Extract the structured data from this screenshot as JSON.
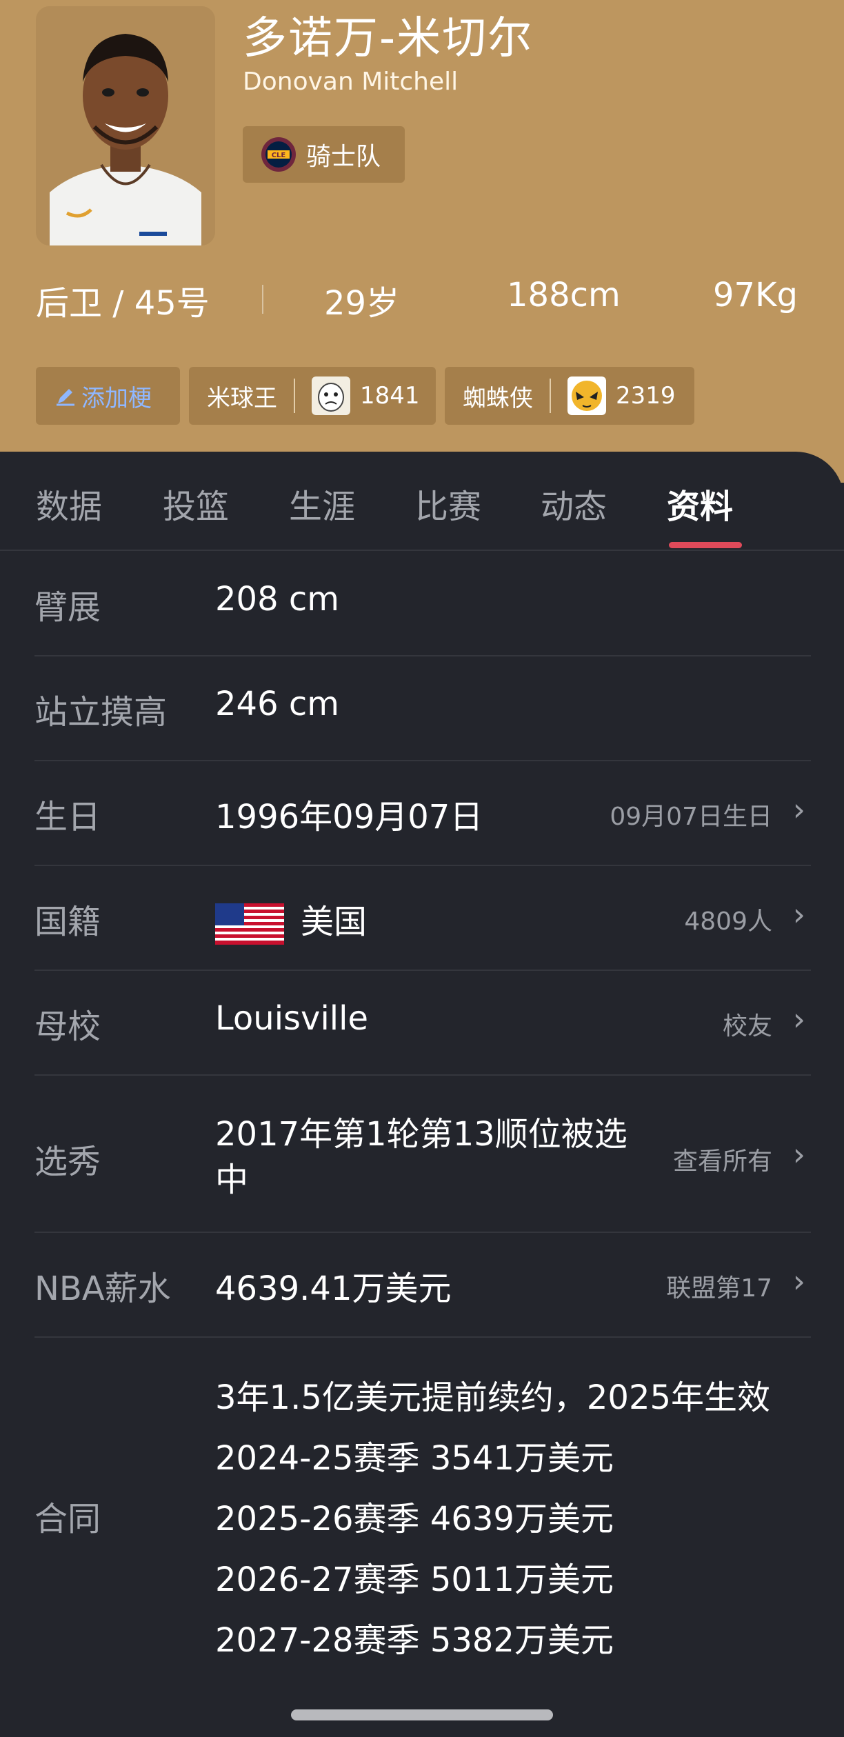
{
  "player": {
    "name_cn": "多诺万-米切尔",
    "name_en": "Donovan Mitchell",
    "team": "骑士队",
    "position_number": "后卫 / 45号",
    "age": "29岁",
    "height": "188cm",
    "weight": "97Kg"
  },
  "tags": {
    "add_label": "添加梗",
    "tag1": {
      "label": "米球王",
      "count": "1841"
    },
    "tag2": {
      "label": "蜘蛛侠",
      "count": "2319"
    }
  },
  "tabs": [
    "数据",
    "投篮",
    "生涯",
    "比赛",
    "动态",
    "资料"
  ],
  "active_tab": "资料",
  "profile": {
    "wingspan": {
      "label": "臂展",
      "value": "208 cm"
    },
    "reach": {
      "label": "站立摸高",
      "value": "246 cm"
    },
    "birthday": {
      "label": "生日",
      "value": "1996年09月07日",
      "extra": "09月07日生日"
    },
    "nationality": {
      "label": "国籍",
      "value": "美国",
      "extra": "4809人"
    },
    "school": {
      "label": "母校",
      "value": "Louisville",
      "extra": "校友"
    },
    "draft": {
      "label": "选秀",
      "value_line1": "2017年第1轮第13顺位被选",
      "value_line2": "中",
      "extra": "查看所有"
    },
    "salary": {
      "label": "NBA薪水",
      "value": "4639.41万美元",
      "extra": "联盟第17"
    },
    "contract": {
      "label": "合同",
      "lines": [
        "3年1.5亿美元提前续约，2025年生效",
        "2024-25赛季 3541万美元",
        "2025-26赛季 4639万美元",
        "2026-27赛季 5011万美元",
        "2027-28赛季 5382万美元"
      ]
    }
  },
  "icons": {
    "edit": "pencil-icon",
    "chevron": "chevron-right-icon",
    "flag": "us-flag-icon"
  },
  "colors": {
    "header_bg": "#bd965f",
    "panel_bg": "#23252c",
    "accent": "#e04a5a",
    "add_tag_text": "#8fb7ff"
  }
}
